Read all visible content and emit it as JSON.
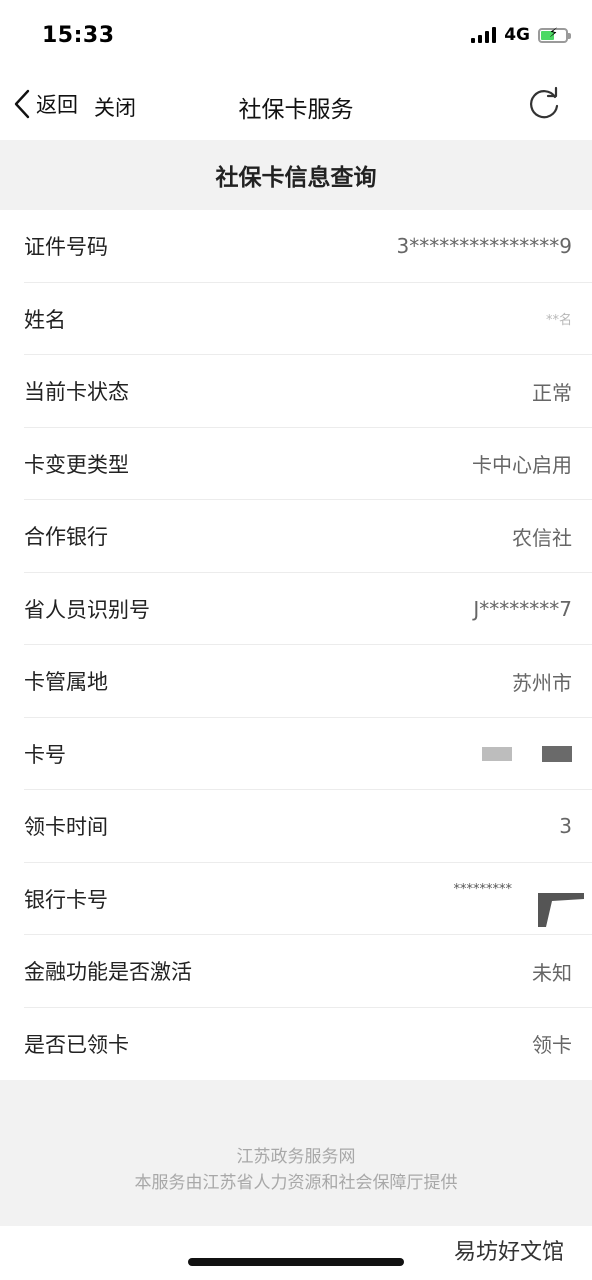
{
  "status_bar": {
    "time": "15:33",
    "network": "4G"
  },
  "nav": {
    "back_label": "返回",
    "close_label": "关闭",
    "title": "社保卡服务",
    "refresh_icon": "refresh-icon"
  },
  "section": {
    "title": "社保卡信息查询"
  },
  "rows": [
    {
      "label": "证件号码",
      "value": "3***************9"
    },
    {
      "label": "姓名",
      "value": "**名"
    },
    {
      "label": "当前卡状态",
      "value": "正常"
    },
    {
      "label": "卡变更类型",
      "value": "卡中心启用"
    },
    {
      "label": "合作银行",
      "value": "农信社"
    },
    {
      "label": "省人员识别号",
      "value": "J********7"
    },
    {
      "label": "卡管属地",
      "value": "苏州市"
    },
    {
      "label": "卡号",
      "value": ""
    },
    {
      "label": "领卡时间",
      "value": "3"
    },
    {
      "label": "银行卡号",
      "value": "*********"
    },
    {
      "label": "金融功能是否激活",
      "value": "未知"
    },
    {
      "label": "是否已领卡",
      "value": "领卡"
    }
  ],
  "footer": {
    "line1": "江苏政务服务网",
    "line2": "本服务由江苏省人力资源和社会保障厅提供"
  },
  "watermark": "易坊好文馆",
  "colors": {
    "section_bg": "#f2f2f2",
    "battery": "#4cd964"
  }
}
